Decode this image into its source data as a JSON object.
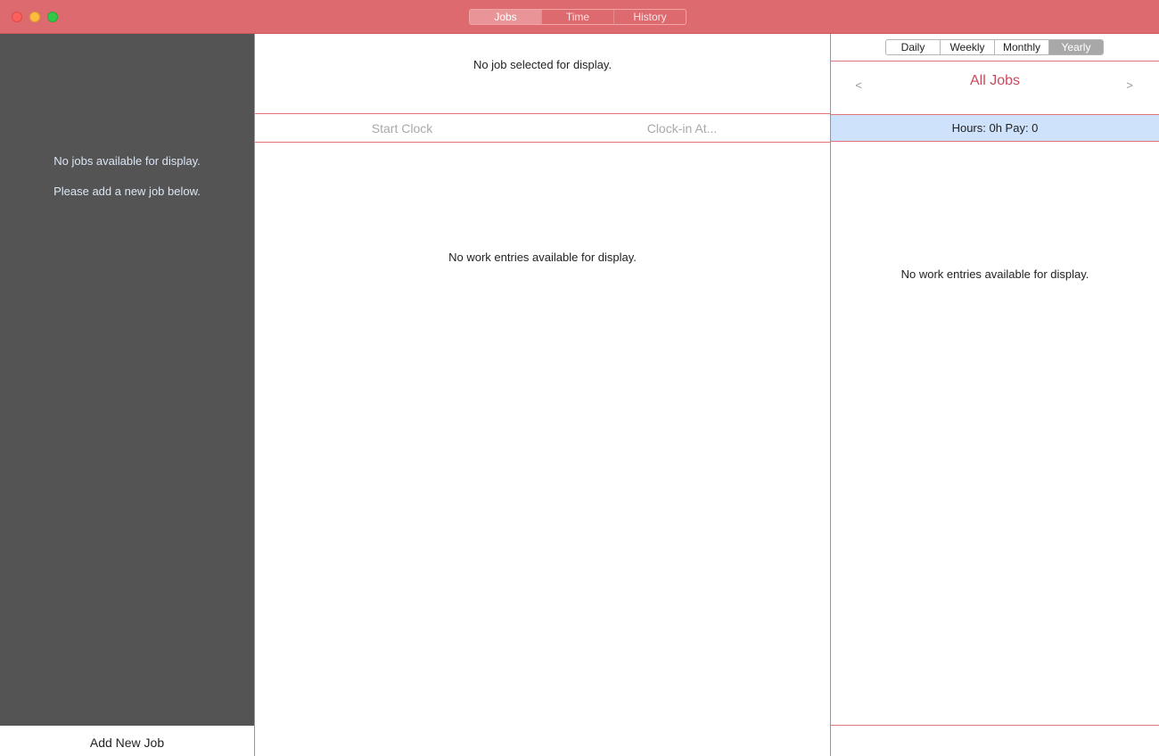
{
  "colors": {
    "titlebar": "#dd6a6e",
    "sidebar": "#545454",
    "divider": "#e0757a",
    "accent_text": "#c94a5b",
    "summary_bg": "#cfe2fb"
  },
  "titlebar": {
    "tabs": [
      {
        "label": "Jobs",
        "active": true
      },
      {
        "label": "Time",
        "active": false
      },
      {
        "label": "History",
        "active": false
      }
    ]
  },
  "sidebar": {
    "empty_line1": "No jobs available for display.",
    "empty_line2": "Please add a new job below.",
    "add_job_label": "Add New Job"
  },
  "job_panel": {
    "header_text": "No job selected for display.",
    "start_clock_label": "Start Clock",
    "clock_in_label": "Clock-in At...",
    "empty_entries": "No work entries available for display."
  },
  "summary_panel": {
    "periods": [
      {
        "label": "Daily",
        "active": false
      },
      {
        "label": "Weekly",
        "active": false
      },
      {
        "label": "Monthly",
        "active": false
      },
      {
        "label": "Yearly",
        "active": true
      }
    ],
    "prev_label": "<",
    "next_label": ">",
    "title": "All Jobs",
    "summary_text": "Hours: 0h  Pay: 0",
    "empty_entries": "No work entries available for display."
  }
}
